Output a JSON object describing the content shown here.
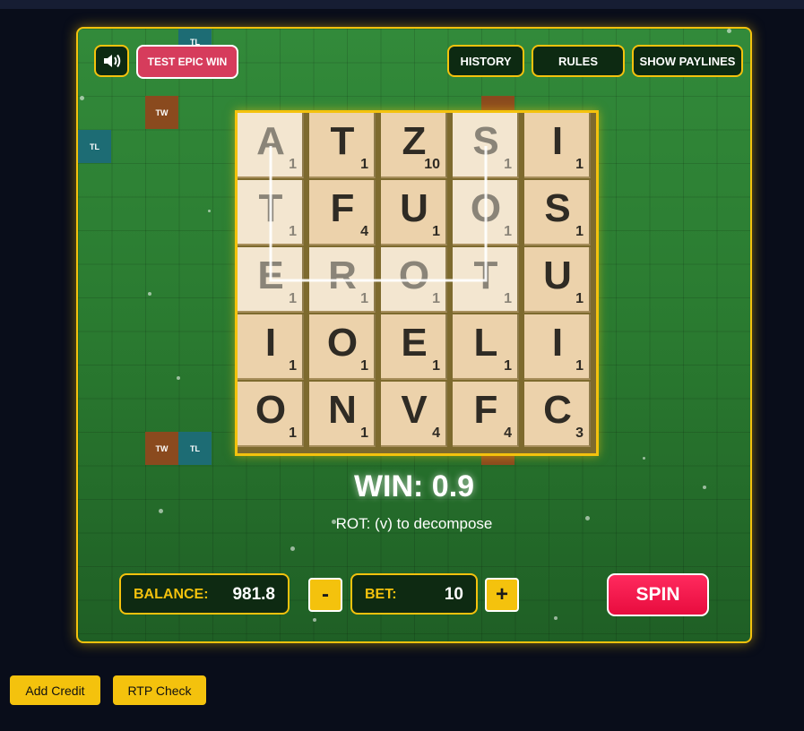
{
  "toolbar": {
    "sound_icon": "speaker-icon",
    "test_epic_win_label": "TEST EPIC WIN",
    "history_label": "HISTORY",
    "rules_label": "RULES",
    "show_paylines_label": "SHOW PAYLINES"
  },
  "background_tiles": {
    "tw_label": "TW",
    "tl_label": "TL"
  },
  "board": {
    "rows": [
      [
        {
          "letter": "A",
          "points": "1"
        },
        {
          "letter": "T",
          "points": "1"
        },
        {
          "letter": "Z",
          "points": "10"
        },
        {
          "letter": "S",
          "points": "1"
        },
        {
          "letter": "I",
          "points": "1"
        }
      ],
      [
        {
          "letter": "T",
          "points": "1"
        },
        {
          "letter": "F",
          "points": "4"
        },
        {
          "letter": "U",
          "points": "1"
        },
        {
          "letter": "O",
          "points": "1"
        },
        {
          "letter": "S",
          "points": "1"
        }
      ],
      [
        {
          "letter": "E",
          "points": "1"
        },
        {
          "letter": "R",
          "points": "1"
        },
        {
          "letter": "O",
          "points": "1"
        },
        {
          "letter": "T",
          "points": "1"
        },
        {
          "letter": "U",
          "points": "1"
        }
      ],
      [
        {
          "letter": "I",
          "points": "1"
        },
        {
          "letter": "O",
          "points": "1"
        },
        {
          "letter": "E",
          "points": "1"
        },
        {
          "letter": "L",
          "points": "1"
        },
        {
          "letter": "I",
          "points": "1"
        }
      ],
      [
        {
          "letter": "O",
          "points": "1"
        },
        {
          "letter": "N",
          "points": "1"
        },
        {
          "letter": "V",
          "points": "4"
        },
        {
          "letter": "F",
          "points": "4"
        },
        {
          "letter": "C",
          "points": "3"
        }
      ]
    ],
    "highlighted_cells": [
      [
        0,
        0
      ],
      [
        1,
        0
      ],
      [
        2,
        0
      ],
      [
        2,
        1
      ],
      [
        2,
        2
      ],
      [
        2,
        3
      ],
      [
        1,
        3
      ],
      [
        0,
        3
      ]
    ]
  },
  "result": {
    "win_text": "WIN: 0.9",
    "word_description": "ROT: (v) to decompose"
  },
  "controls": {
    "balance_label": "BALANCE:",
    "balance_value": "981.8",
    "minus_label": "-",
    "bet_label": "BET:",
    "bet_value": "10",
    "plus_label": "+",
    "spin_label": "SPIN"
  },
  "external": {
    "add_credit_label": "Add Credit",
    "rtp_check_label": "RTP Check"
  },
  "colors": {
    "accent": "#f4c20d",
    "spin": "#ff1f4f",
    "epic_win": "#d63c5c",
    "felt": "#2b7a32"
  }
}
